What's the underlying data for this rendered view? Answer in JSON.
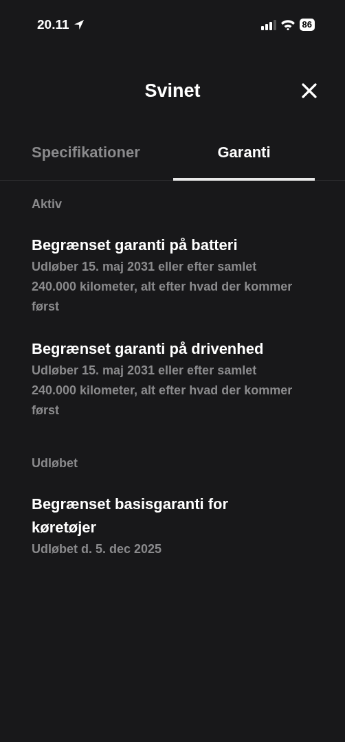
{
  "status_bar": {
    "time": "20.11",
    "battery": "86"
  },
  "header": {
    "title": "Svinet"
  },
  "tabs": [
    {
      "label": "Specifikationer",
      "selected": false
    },
    {
      "label": "Garanti",
      "selected": true
    }
  ],
  "sections": [
    {
      "heading": "Aktiv",
      "items": [
        {
          "title": "Begrænset garanti på batteri",
          "detail": "Udløber 15. maj 2031 eller efter samlet 240.000 kilometer, alt efter hvad der kommer først"
        },
        {
          "title": "Begrænset garanti på drivenhed",
          "detail": "Udløber 15. maj 2031 eller efter samlet 240.000 kilometer, alt efter hvad der kommer først"
        }
      ]
    },
    {
      "heading": "Udløbet",
      "items": [
        {
          "title": "Begrænset basisgaranti for køretøjer",
          "detail": "Udløbet d. 5. dec 2025"
        }
      ]
    }
  ]
}
